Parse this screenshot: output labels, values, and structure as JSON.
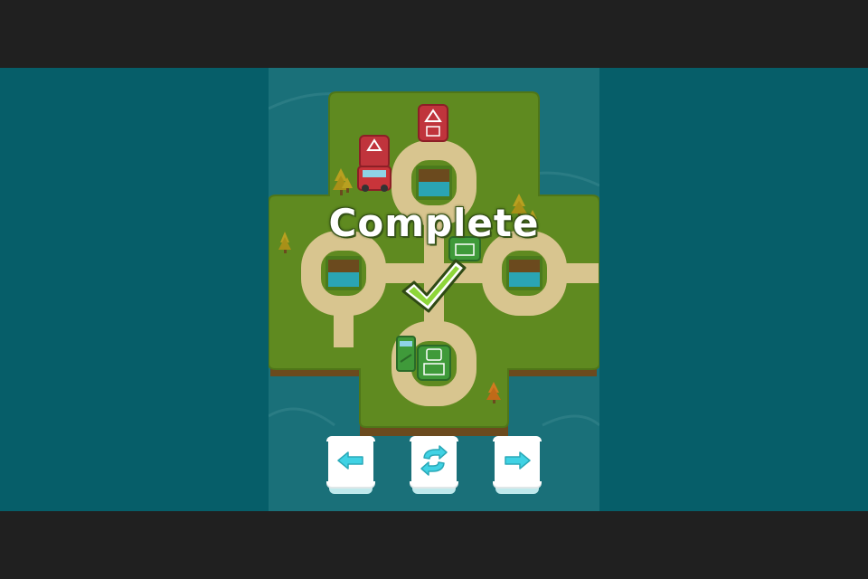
{
  "game": {
    "status_text": "Complete"
  },
  "icons": {
    "status": "checkmark-icon",
    "controls": [
      "arrow-left-icon",
      "restart-icon",
      "arrow-right-icon"
    ]
  },
  "colors": {
    "water": "#065e69",
    "grass": "#5f8a20",
    "road": "#d8c58f",
    "red_vehicle": "#c0343c",
    "green_vehicle": "#3f9a3a",
    "accent_cyan": "#40d2e4"
  }
}
